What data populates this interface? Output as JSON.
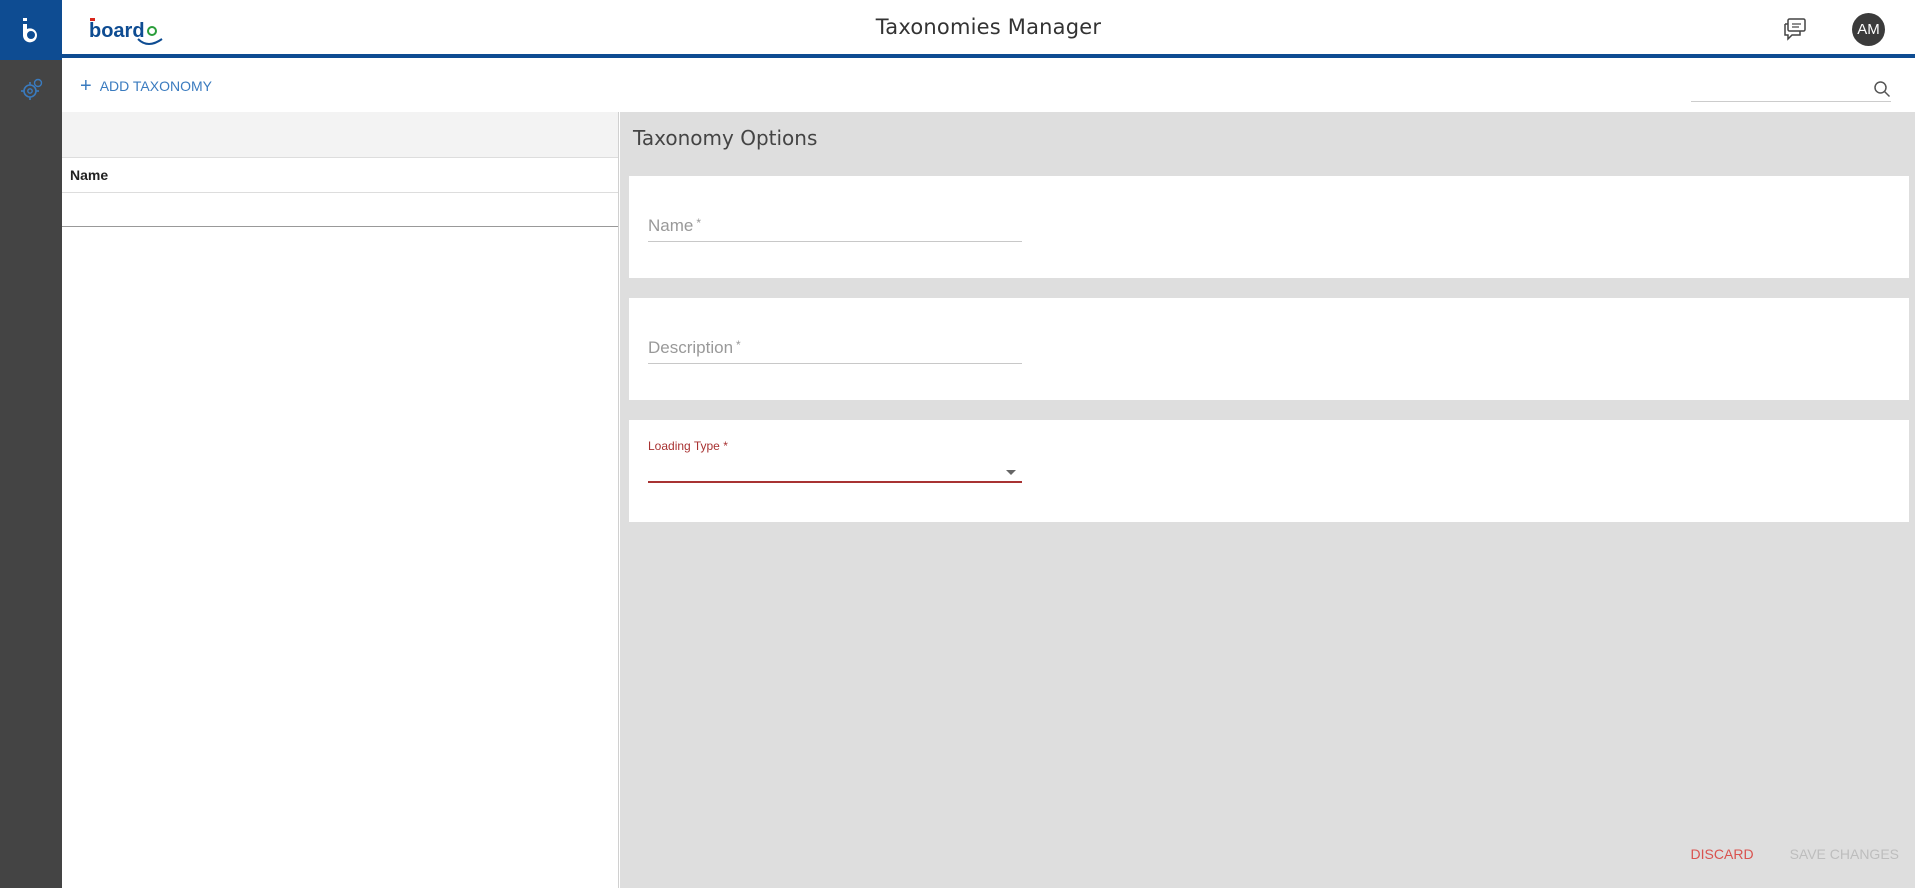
{
  "app": {
    "rail_logo_letter": "b",
    "brand_name": "board",
    "title": "Taxonomies Manager",
    "user_initials": "AM"
  },
  "toolbar": {
    "add_label": "ADD TAXONOMY",
    "search_placeholder": ""
  },
  "list": {
    "column_name": "Name"
  },
  "options": {
    "title": "Taxonomy Options",
    "name_label": "Name",
    "description_label": "Description",
    "loading_type_label": "Loading Type",
    "required_marker": "*",
    "loading_type_value": ""
  },
  "actions": {
    "discard_label": "DISCARD",
    "save_label": "SAVE CHANGES"
  },
  "colors": {
    "brand_blue": "#0e4c92",
    "rail_gray": "#444444",
    "link_blue": "#3a7bbf",
    "error_red": "#a83232",
    "discard_red": "#d9534f"
  }
}
